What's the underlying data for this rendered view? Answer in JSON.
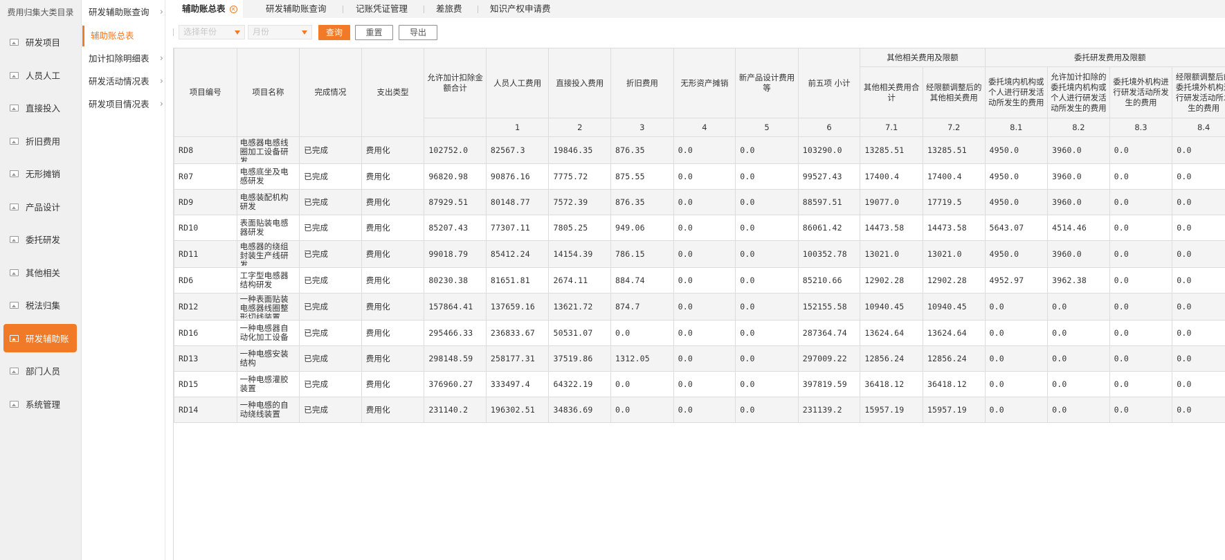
{
  "sidebar": {
    "title": "费用归集大类目录",
    "items": [
      {
        "label": "研发项目",
        "active": false
      },
      {
        "label": "人员人工",
        "active": false
      },
      {
        "label": "直接投入",
        "active": false
      },
      {
        "label": "折旧费用",
        "active": false
      },
      {
        "label": "无形摊销",
        "active": false
      },
      {
        "label": "产品设计",
        "active": false
      },
      {
        "label": "委托研发",
        "active": false
      },
      {
        "label": "其他相关",
        "active": false
      },
      {
        "label": "税法归集",
        "active": false
      },
      {
        "label": "研发辅助账",
        "active": true
      },
      {
        "label": "部门人员",
        "active": false
      },
      {
        "label": "系统管理",
        "active": false
      }
    ]
  },
  "submenu": {
    "items": [
      {
        "label": "研发辅助账查询",
        "has_chevron": true,
        "active": false
      },
      {
        "label": "辅助账总表",
        "has_chevron": false,
        "active": true
      },
      {
        "label": "加计扣除明细表",
        "has_chevron": true,
        "active": false
      },
      {
        "label": "研发活动情况表",
        "has_chevron": true,
        "active": false
      },
      {
        "label": "研发项目情况表",
        "has_chevron": true,
        "active": false
      }
    ]
  },
  "tabs": [
    {
      "label": "辅助账总表",
      "active": true,
      "closable": true
    },
    {
      "label": "研发辅助账查询",
      "active": false
    },
    {
      "label": "记账凭证管理",
      "active": false
    },
    {
      "label": "差旅费",
      "active": false
    },
    {
      "label": "知识产权申请费",
      "active": false
    }
  ],
  "toolbar": {
    "year_placeholder": "选择年份",
    "month_placeholder": "月份",
    "query_label": "查询",
    "reset_label": "重置",
    "export_label": "导出"
  },
  "table": {
    "headers": {
      "code": "项目编号",
      "name": "项目名称",
      "status": "完成情况",
      "type": "支出类型",
      "allowed_total": "允许加计扣除金额合计",
      "c1": "人员人工费用",
      "c2": "直接投入费用",
      "c3": "折旧费用",
      "c4": "无形资产摊销",
      "c5": "新产品设计费用等",
      "c6": "前五项 小计",
      "group7": "其他相关费用及限额",
      "c71": "其他相关费用合计",
      "c72": "经限额调整后的其他相关费用",
      "group8": "委托研发费用及限额",
      "c81": "委托境内机构或个人进行研发活动所发生的费用",
      "c82": "允许加计扣除的委托境内机构或个人进行研发活动所发生的费用",
      "c83": "委托境外机构进行研发活动所发生的费用",
      "c84": "经限额调整后的委托境外机构进行研发活动所发生的费用"
    },
    "numbers": [
      "1",
      "2",
      "3",
      "4",
      "5",
      "6",
      "7.1",
      "7.2",
      "8.1",
      "8.2",
      "8.3",
      "8.4"
    ],
    "rows": [
      [
        "RD8",
        "电感器电感线圈加工设备研发",
        "已完成",
        "费用化",
        "102752.0",
        "82567.3",
        "19846.35",
        "876.35",
        "0.0",
        "0.0",
        "103290.0",
        "13285.51",
        "13285.51",
        "4950.0",
        "3960.0",
        "0.0",
        "0.0"
      ],
      [
        "R07",
        "电感底坐及电感研发",
        "已完成",
        "费用化",
        "96820.98",
        "90876.16",
        "7775.72",
        "875.55",
        "0.0",
        "0.0",
        "99527.43",
        "17400.4",
        "17400.4",
        "4950.0",
        "3960.0",
        "0.0",
        "0.0"
      ],
      [
        "RD9",
        "电感装配机构研发",
        "已完成",
        "费用化",
        "87929.51",
        "80148.77",
        "7572.39",
        "876.35",
        "0.0",
        "0.0",
        "88597.51",
        "19077.0",
        "17719.5",
        "4950.0",
        "3960.0",
        "0.0",
        "0.0"
      ],
      [
        "RD10",
        "表面贴装电感器研发",
        "已完成",
        "费用化",
        "85207.43",
        "77307.11",
        "7805.25",
        "949.06",
        "0.0",
        "0.0",
        "86061.42",
        "14473.58",
        "14473.58",
        "5643.07",
        "4514.46",
        "0.0",
        "0.0"
      ],
      [
        "RD11",
        "电感器的绕组封装生产线研发",
        "已完成",
        "费用化",
        "99018.79",
        "85412.24",
        "14154.39",
        "786.15",
        "0.0",
        "0.0",
        "100352.78",
        "13021.0",
        "13021.0",
        "4950.0",
        "3960.0",
        "0.0",
        "0.0"
      ],
      [
        "RD6",
        "工字型电感器结构研发",
        "已完成",
        "费用化",
        "80230.38",
        "81651.81",
        "2674.11",
        "884.74",
        "0.0",
        "0.0",
        "85210.66",
        "12902.28",
        "12902.28",
        "4952.97",
        "3962.38",
        "0.0",
        "0.0"
      ],
      [
        "RD12",
        "一种表面贴装电感器线圈整形切线装置",
        "已完成",
        "费用化",
        "157864.41",
        "137659.16",
        "13621.72",
        "874.7",
        "0.0",
        "0.0",
        "152155.58",
        "10940.45",
        "10940.45",
        "0.0",
        "0.0",
        "0.0",
        "0.0"
      ],
      [
        "RD16",
        "一种电感器自动化加工设备",
        "已完成",
        "费用化",
        "295466.33",
        "236833.67",
        "50531.07",
        "0.0",
        "0.0",
        "0.0",
        "287364.74",
        "13624.64",
        "13624.64",
        "0.0",
        "0.0",
        "0.0",
        "0.0"
      ],
      [
        "RD13",
        "一种电感安装结构",
        "已完成",
        "费用化",
        "298148.59",
        "258177.31",
        "37519.86",
        "1312.05",
        "0.0",
        "0.0",
        "297009.22",
        "12856.24",
        "12856.24",
        "0.0",
        "0.0",
        "0.0",
        "0.0"
      ],
      [
        "RD15",
        "一种电感灌胶装置",
        "已完成",
        "费用化",
        "376960.27",
        "333497.4",
        "64322.19",
        "0.0",
        "0.0",
        "0.0",
        "397819.59",
        "36418.12",
        "36418.12",
        "0.0",
        "0.0",
        "0.0",
        "0.0"
      ],
      [
        "RD14",
        "一种电感的自动绕线装置",
        "已完成",
        "费用化",
        "231140.2",
        "196302.51",
        "34836.69",
        "0.0",
        "0.0",
        "0.0",
        "231139.2",
        "15957.19",
        "15957.19",
        "0.0",
        "0.0",
        "0.0",
        "0.0"
      ]
    ]
  }
}
